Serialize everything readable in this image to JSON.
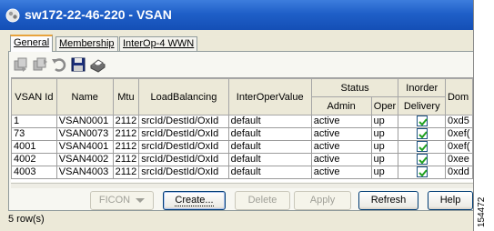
{
  "window": {
    "title": "sw172-22-46-220 - VSAN"
  },
  "tabs": [
    {
      "label": "General",
      "active": true
    },
    {
      "label": "Membership",
      "active": false
    },
    {
      "label": "InterOp-4 WWN",
      "active": false
    }
  ],
  "toolbar": {
    "icons": [
      "copy-icon",
      "paste-icon",
      "undo-icon",
      "save-icon",
      "print-icon"
    ]
  },
  "table": {
    "group_headers": {
      "status": "Status",
      "inorder": "Inorder",
      "inorder2": "Delivery"
    },
    "columns": [
      "VSAN Id",
      "Name",
      "Mtu",
      "LoadBalancing",
      "InterOperValue",
      "Admin",
      "Oper",
      "Delivery",
      "Domain"
    ],
    "column_display": {
      "domain": "Dom"
    },
    "rows": [
      {
        "id": "1",
        "name": "VSAN0001",
        "mtu": "2112",
        "lb": "srcId/DestId/OxId",
        "interop": "default",
        "admin": "active",
        "oper": "up",
        "inorder": true,
        "domain": "0xd5"
      },
      {
        "id": "73",
        "name": "VSAN0073",
        "mtu": "2112",
        "lb": "srcId/DestId/OxId",
        "interop": "default",
        "admin": "active",
        "oper": "up",
        "inorder": true,
        "domain": "0xef("
      },
      {
        "id": "4001",
        "name": "VSAN4001",
        "mtu": "2112",
        "lb": "srcId/DestId/OxId",
        "interop": "default",
        "admin": "active",
        "oper": "up",
        "inorder": true,
        "domain": "0xef("
      },
      {
        "id": "4002",
        "name": "VSAN4002",
        "mtu": "2112",
        "lb": "srcId/DestId/OxId",
        "interop": "default",
        "admin": "active",
        "oper": "up",
        "inorder": true,
        "domain": "0xee"
      },
      {
        "id": "4003",
        "name": "VSAN4003",
        "mtu": "2112",
        "lb": "srcId/DestId/OxId",
        "interop": "default",
        "admin": "active",
        "oper": "up",
        "inorder": true,
        "domain": "0xdd"
      }
    ]
  },
  "buttons": {
    "ficon": "FICON",
    "create": "Create...",
    "delete": "Delete",
    "apply": "Apply",
    "refresh": "Refresh",
    "help": "Help"
  },
  "status": {
    "row_count": "5 row(s)"
  },
  "figure_id": "154472",
  "colors": {
    "titlebar": "#1f5fc8",
    "tab_accent": "#e8a33d",
    "check": "#21a121"
  }
}
